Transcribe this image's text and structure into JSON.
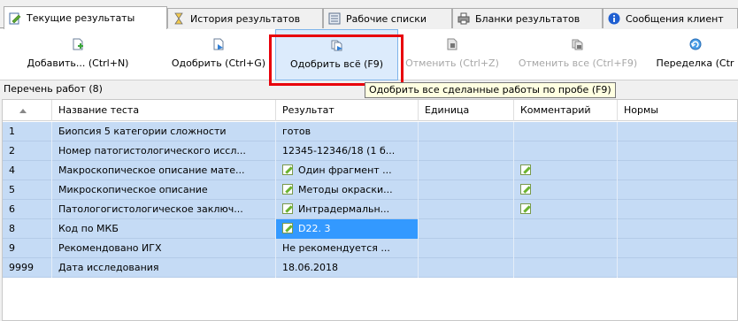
{
  "tabs": [
    {
      "label": "Текущие результаты",
      "icon": "edit-document-icon",
      "active": true
    },
    {
      "label": "История результатов",
      "icon": "hourglass-icon",
      "active": false
    },
    {
      "label": "Рабочие списки",
      "icon": "worklist-icon",
      "active": false
    },
    {
      "label": "Бланки результатов",
      "icon": "printer-icon",
      "active": false
    },
    {
      "label": "Сообщения клиент",
      "icon": "info-icon",
      "active": false
    }
  ],
  "toolbar": {
    "add": "Добавить... (Ctrl+N)",
    "approve": "Одобрить (Ctrl+G)",
    "approve_all": "Одобрить всё (F9)",
    "cancel": "Отменить (Ctrl+Z)",
    "cancel_all": "Отменить все (Ctrl+F9)",
    "redo": "Переделка (Ctr"
  },
  "tooltip": "Одобрить все сделанные работы по пробе (F9)",
  "section_label": "Перечень работ (8)",
  "grid": {
    "columns": [
      "Название теста",
      "Результат",
      "Единица",
      "Комментарий",
      "Нормы"
    ],
    "rows": [
      {
        "num": "1",
        "name": "Биопсия 5 категории сложности",
        "result": "готов",
        "result_icon": false,
        "comment_icon": false
      },
      {
        "num": "2",
        "name": "Номер патогистологического иссл...",
        "result": "12345-12346/18 (1 б...",
        "result_icon": false,
        "comment_icon": false
      },
      {
        "num": "4",
        "name": "Макроскопическое описание мате...",
        "result": "Один фрагмент ...",
        "result_icon": true,
        "comment_icon": true
      },
      {
        "num": "5",
        "name": "Микроскопическое описание",
        "result": "Методы окраски...",
        "result_icon": true,
        "comment_icon": true
      },
      {
        "num": "6",
        "name": "Патологогистологическое заключ...",
        "result": "Интрадермальн...",
        "result_icon": true,
        "comment_icon": true
      },
      {
        "num": "8",
        "name": "Код по МКБ",
        "result": "D22. 3",
        "result_icon": true,
        "comment_icon": false,
        "selected": true
      },
      {
        "num": "9",
        "name": "Рекомендовано ИГХ",
        "result": "Не рекомендуется ...",
        "result_icon": false,
        "comment_icon": false
      },
      {
        "num": "9999",
        "name": "Дата исследования",
        "result": "18.06.2018",
        "result_icon": false,
        "comment_icon": false
      }
    ]
  },
  "colors": {
    "row_bg": "#c5dbf5",
    "selected_bg": "#3399ff",
    "highlight_border": "#e8000b",
    "tooltip_bg": "#ffffe1"
  }
}
